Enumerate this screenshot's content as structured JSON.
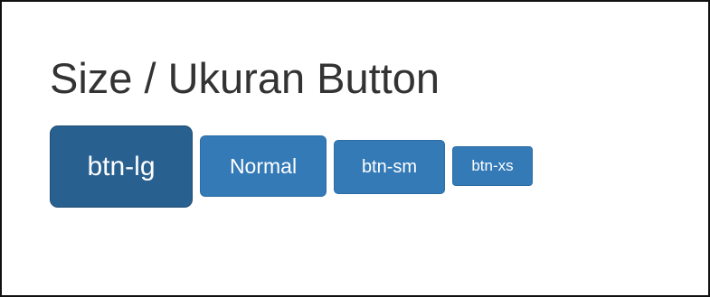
{
  "page": {
    "title": "Size / Ukuran Button"
  },
  "buttons": {
    "large": "btn-lg",
    "normal": "Normal",
    "small": "btn-sm",
    "extra_small": "btn-xs"
  },
  "colors": {
    "primary": "#337ab7",
    "primary_active": "#286090",
    "title_text": "#333333",
    "button_text": "#ffffff"
  }
}
